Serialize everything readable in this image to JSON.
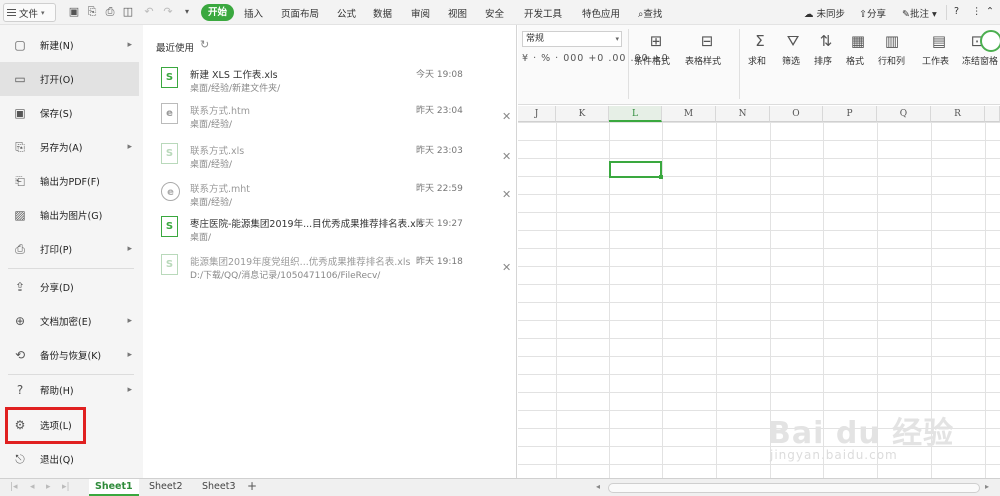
{
  "top_bar": {
    "file_label": "文件",
    "tabs": [
      "开始",
      "插入",
      "页面布局",
      "公式",
      "数据",
      "审阅",
      "视图",
      "安全",
      "开发工具",
      "特色应用"
    ],
    "active_tab": "开始",
    "search_label": "查找",
    "right": {
      "sync": "未同步",
      "share": "分享",
      "comment": "批注",
      "help": "?"
    }
  },
  "ribbon": {
    "number_format": "常规",
    "number_symbols": "¥ · % · 000  +0 .00  .00 +0",
    "buttons": [
      "条件格式",
      "表格样式",
      "求和",
      "筛选",
      "排序",
      "格式",
      "行和列",
      "工作表",
      "冻结窗格"
    ]
  },
  "grid": {
    "columns": [
      "J",
      "K",
      "L",
      "M",
      "N",
      "O",
      "P",
      "Q",
      "R"
    ],
    "selected_column": "L"
  },
  "file_menu": {
    "items": [
      {
        "label": "新建(N)",
        "icon": "new-doc-icon",
        "has_submenu": true
      },
      {
        "label": "打开(O)",
        "icon": "folder-open-icon",
        "has_submenu": false
      },
      {
        "label": "保存(S)",
        "icon": "save-icon",
        "has_submenu": false
      },
      {
        "label": "另存为(A)",
        "icon": "save-as-icon",
        "has_submenu": true
      },
      {
        "label": "输出为PDF(F)",
        "icon": "pdf-icon",
        "has_submenu": false
      },
      {
        "label": "输出为图片(G)",
        "icon": "image-icon",
        "has_submenu": false
      },
      {
        "label": "打印(P)",
        "icon": "print-icon",
        "has_submenu": true
      },
      {
        "label": "分享(D)",
        "icon": "share-icon",
        "has_submenu": false
      },
      {
        "label": "文档加密(E)",
        "icon": "lock-icon",
        "has_submenu": true
      },
      {
        "label": "备份与恢复(K)",
        "icon": "backup-icon",
        "has_submenu": true
      },
      {
        "label": "帮助(H)",
        "icon": "help-icon",
        "has_submenu": true
      },
      {
        "label": "选项(L)",
        "icon": "gear-icon",
        "has_submenu": false
      },
      {
        "label": "退出(Q)",
        "icon": "exit-icon",
        "has_submenu": false
      }
    ],
    "highlighted": "打开(O)",
    "boxed": "选项(L)"
  },
  "recent": {
    "title": "最近使用",
    "files": [
      {
        "name": "新建 XLS 工作表.xls",
        "path": "桌面/经验/新建文件夹/",
        "time": "今天 19:08",
        "type": "xls"
      },
      {
        "name": "联系方式.htm",
        "path": "桌面/经验/",
        "time": "昨天 23:04",
        "type": "htm"
      },
      {
        "name": "联系方式.xls",
        "path": "桌面/经验/",
        "time": "昨天 23:03",
        "type": "xls-dim"
      },
      {
        "name": "联系方式.mht",
        "path": "桌面/经验/",
        "time": "昨天 22:59",
        "type": "mht"
      },
      {
        "name": "枣庄医院-能源集团2019年...目优秀成果推荐排名表.xls",
        "path": "桌面/",
        "time": "昨天 19:27",
        "type": "xls"
      },
      {
        "name": "能源集团2019年度党组织...优秀成果推荐排名表.xls",
        "path": "D:/下载/QQ/消息记录/1050471106/FileRecv/",
        "time": "昨天 19:18",
        "type": "xls-dim"
      }
    ]
  },
  "sheets": [
    "Sheet1",
    "Sheet2",
    "Sheet3"
  ],
  "active_sheet": "Sheet1",
  "watermark": {
    "logo": "Bai du 经验",
    "url": "jingyan.baidu.com"
  },
  "colors": {
    "accent": "#3aa83f",
    "highlight_box": "#e02020"
  }
}
